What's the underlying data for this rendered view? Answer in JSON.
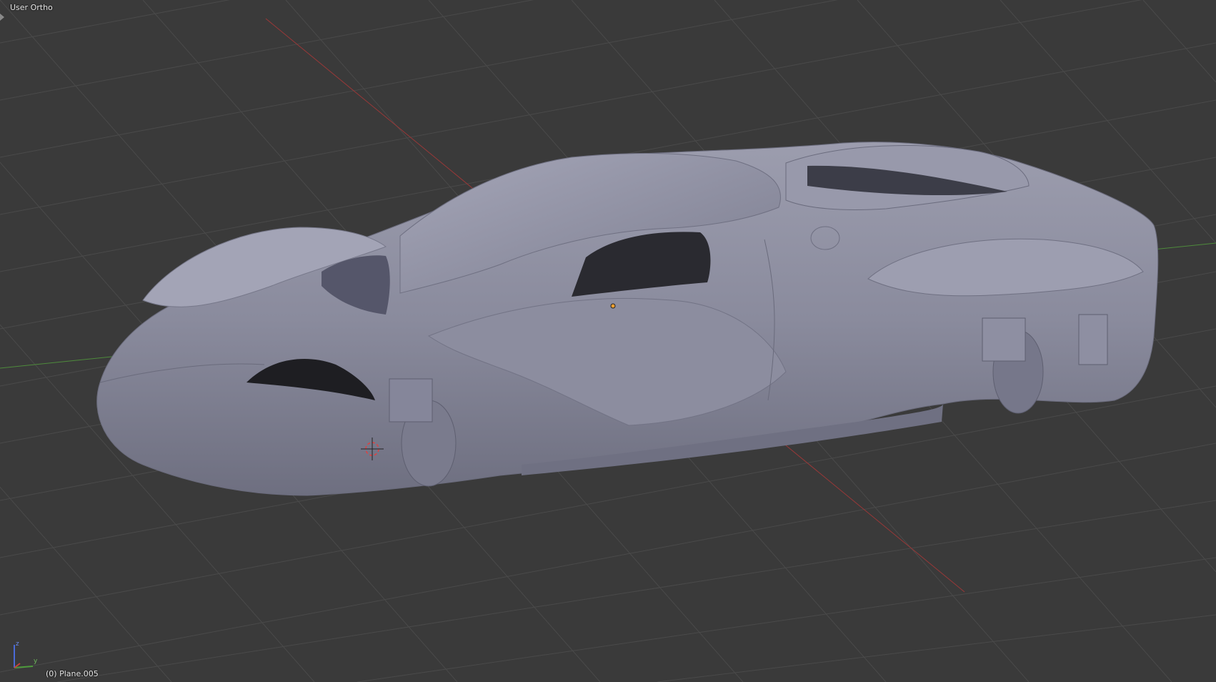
{
  "viewport": {
    "view_name": "User Ortho",
    "active_object": "(0) Plane.005",
    "background_color": "#3a3a3a",
    "grid_color": "#4a4a4a",
    "x_axis_color": "#9a3838",
    "y_axis_color": "#4e8b3c",
    "mesh_color": "#8e8fa2"
  },
  "gizmo": {
    "z_label": "z",
    "y_label": "y"
  }
}
